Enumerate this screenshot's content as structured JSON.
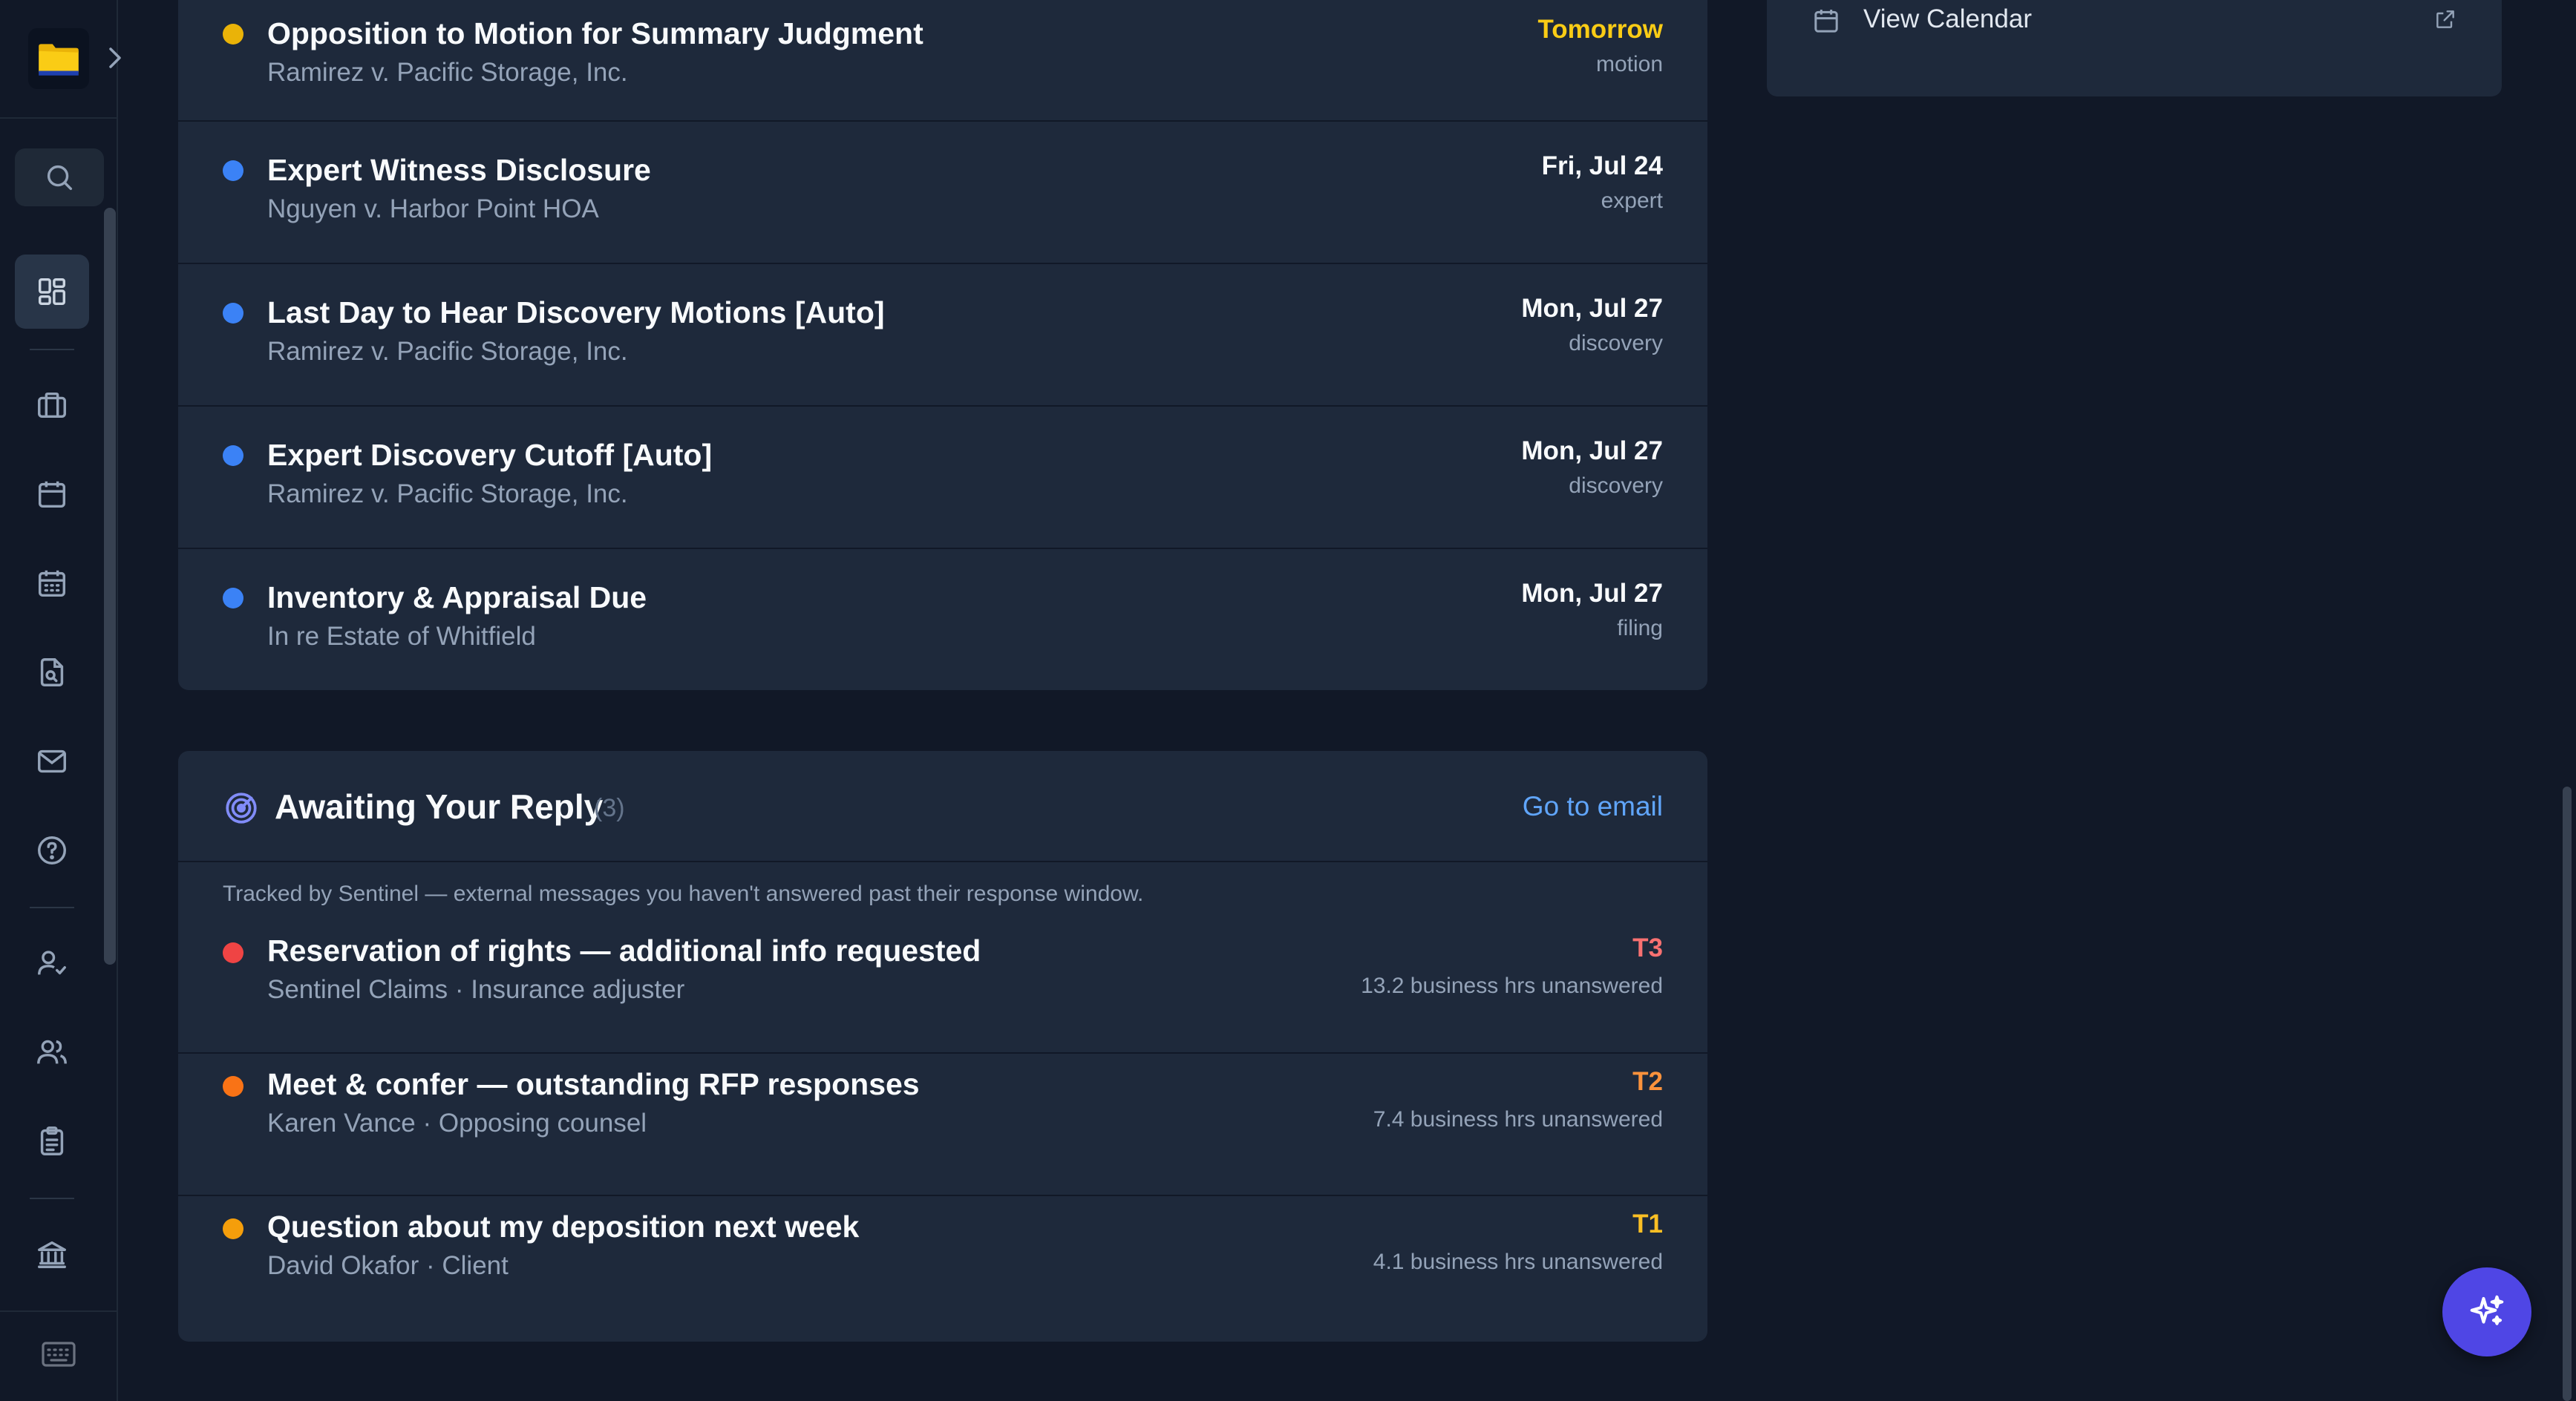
{
  "colors": {
    "yellow": "#eab308",
    "blue": "#3b82f6",
    "red": "#ef4444",
    "orange": "#f97316",
    "tomorrow": "#facc15",
    "t3": "#f87171",
    "t2": "#fb923c",
    "t1": "#fbbf24",
    "accent": "#4f46e5"
  },
  "deadlines": [
    {
      "title": "Opposition to Motion for Summary Judgment",
      "case": "Ramirez v. Pacific Storage, Inc.",
      "date": "Tomorrow",
      "type": "motion",
      "dot": "yellow"
    },
    {
      "title": "Expert Witness Disclosure",
      "case": "Nguyen v. Harbor Point HOA",
      "date": "Fri, Jul 24",
      "type": "expert",
      "dot": "blue"
    },
    {
      "title": "Last Day to Hear Discovery Motions [Auto]",
      "case": "Ramirez v. Pacific Storage, Inc.",
      "date": "Mon, Jul 27",
      "type": "discovery",
      "dot": "blue"
    },
    {
      "title": "Expert Discovery Cutoff [Auto]",
      "case": "Ramirez v. Pacific Storage, Inc.",
      "date": "Mon, Jul 27",
      "type": "discovery",
      "dot": "blue"
    },
    {
      "title": "Inventory & Appraisal Due",
      "case": "In re Estate of Whitfield",
      "date": "Mon, Jul 27",
      "type": "filing",
      "dot": "blue"
    }
  ],
  "reply": {
    "title": "Awaiting Your Reply",
    "count": "(3)",
    "goto_label": "Go to email",
    "note": "Tracked by Sentinel — external messages you haven't answered past their response window.",
    "items": [
      {
        "title": "Reservation of rights — additional info requested",
        "from": "Sentinel Claims",
        "role": "Insurance adjuster",
        "tier": "T3",
        "hours": "13.2 business hrs unanswered"
      },
      {
        "title": "Meet & confer — outstanding RFP responses",
        "from": "Karen Vance",
        "role": "Opposing counsel",
        "tier": "T2",
        "hours": "7.4 business hrs unanswered"
      },
      {
        "title": "Question about my deposition next week",
        "from": "David Okafor",
        "role": "Client",
        "tier": "T1",
        "hours": "4.1 business hrs unanswered"
      }
    ]
  },
  "right_panel": {
    "view_calendar": "View Calendar"
  },
  "separator": "·"
}
